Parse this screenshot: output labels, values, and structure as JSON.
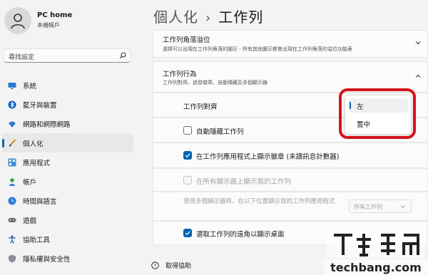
{
  "user": {
    "name": "PC home",
    "subtitle": "本機帳戶"
  },
  "search": {
    "placeholder": "尋找設定"
  },
  "nav": [
    {
      "label": "系統",
      "icon": "monitor-icon"
    },
    {
      "label": "藍牙與裝置",
      "icon": "bluetooth-icon"
    },
    {
      "label": "網路和網際網路",
      "icon": "wifi-icon"
    },
    {
      "label": "個人化",
      "icon": "brush-icon",
      "selected": true
    },
    {
      "label": "應用程式",
      "icon": "apps-icon"
    },
    {
      "label": "帳戶",
      "icon": "person-icon"
    },
    {
      "label": "時間與語言",
      "icon": "globe-clock-icon"
    },
    {
      "label": "遊戲",
      "icon": "gamepad-icon"
    },
    {
      "label": "協助工具",
      "icon": "accessibility-icon"
    },
    {
      "label": "隱私權與安全性",
      "icon": "shield-icon"
    }
  ],
  "help": {
    "label": "取得協助",
    "icon": "help-icon"
  },
  "breadcrumb": {
    "parent": "個人化",
    "separator": "›",
    "current": "工作列"
  },
  "overflow_card": {
    "title": "工作列角落溢位",
    "subtitle": "選擇可以出現在工作列角落的圖示 - 所有其他圖示都會出現在工作列角落的溢位功能表"
  },
  "behaviors": {
    "title": "工作列行為",
    "subtitle": "工作列對齊、過發徽章、自動隱藏及多個顯示器",
    "alignment": {
      "label": "工作列對齊",
      "options": [
        "左",
        "置中"
      ],
      "selected": "左"
    },
    "auto_hide": {
      "label": "自動隱藏工作列",
      "checked": false
    },
    "badges": {
      "label": "在工作列應用程式上顯示徽章 (未讀訊息計數器)",
      "checked": true
    },
    "all_displays": {
      "label": "在所有顯示器上顯示我的工作列",
      "checked": false,
      "disabled": true
    },
    "multi_display": {
      "label": "使用多個顯示器時，在以下位置顯示我的工作列應用程式",
      "value": "所有工作列",
      "disabled": true
    },
    "far_corner": {
      "label": "選取工作列的遠角以顯示桌面",
      "checked": true
    }
  },
  "colors": {
    "accent": "#0063b1",
    "highlight_ring": "#d8121a"
  },
  "watermark": {
    "text": "techbang.com"
  }
}
